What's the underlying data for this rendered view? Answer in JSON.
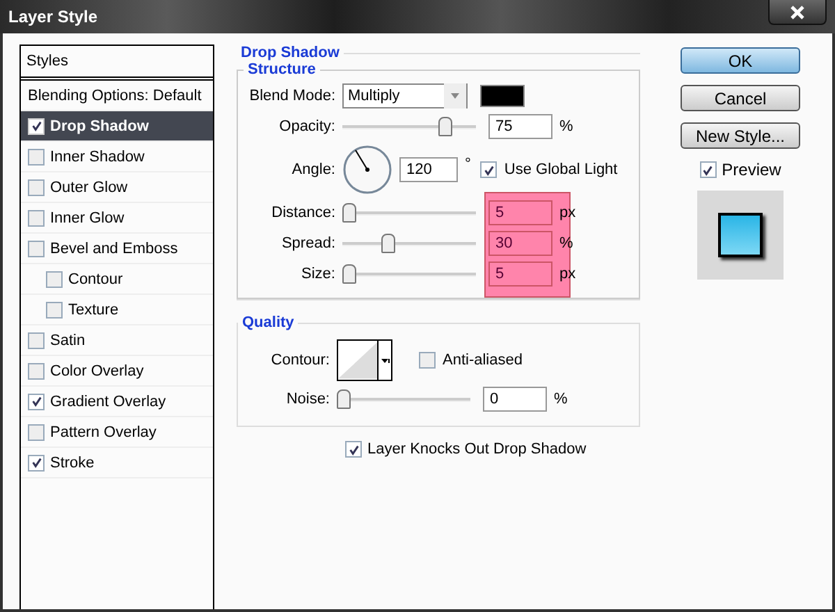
{
  "window": {
    "title": "Layer Style"
  },
  "styles_list": {
    "header": "Styles",
    "items": [
      {
        "kind": "plain",
        "label": "Blending Options: Default",
        "selected": false
      },
      {
        "kind": "check",
        "label": "Drop Shadow",
        "checked": true,
        "selected": true
      },
      {
        "kind": "check",
        "label": "Inner Shadow",
        "checked": false,
        "selected": false
      },
      {
        "kind": "check",
        "label": "Outer Glow",
        "checked": false,
        "selected": false
      },
      {
        "kind": "check",
        "label": "Inner Glow",
        "checked": false,
        "selected": false
      },
      {
        "kind": "check",
        "label": "Bevel and Emboss",
        "checked": false,
        "selected": false,
        "children": [
          {
            "kind": "check",
            "label": "Contour",
            "checked": false,
            "selected": false
          },
          {
            "kind": "check",
            "label": "Texture",
            "checked": false,
            "selected": false
          }
        ]
      },
      {
        "kind": "check",
        "label": "Satin",
        "checked": false,
        "selected": false
      },
      {
        "kind": "check",
        "label": "Color Overlay",
        "checked": false,
        "selected": false
      },
      {
        "kind": "check",
        "label": "Gradient Overlay",
        "checked": true,
        "selected": false
      },
      {
        "kind": "check",
        "label": "Pattern Overlay",
        "checked": false,
        "selected": false
      },
      {
        "kind": "check",
        "label": "Stroke",
        "checked": true,
        "selected": false
      }
    ]
  },
  "drop_shadow": {
    "title": "Drop Shadow",
    "structure": {
      "title": "Structure",
      "blend_mode": {
        "label": "Blend Mode:",
        "value": "Multiply"
      },
      "opacity": {
        "label": "Opacity:",
        "level": 0.75,
        "value": "75",
        "unit": "%"
      },
      "angle": {
        "label": "Angle:",
        "value": "120",
        "unit": "°"
      },
      "use_global_light": {
        "label": "Use Global Light",
        "checked": true
      },
      "highlighted": [
        {
          "label": "Distance:",
          "level": 0,
          "value": "5",
          "unit": "px"
        },
        {
          "label": "Spread:",
          "level": 0.3,
          "value": "30",
          "unit": "%"
        },
        {
          "label": "Size:",
          "level": 0,
          "value": "5",
          "unit": "px"
        }
      ]
    },
    "quality": {
      "title": "Quality",
      "contour": {
        "label": "Contour:"
      },
      "anti_aliased": {
        "label": "Anti-aliased",
        "checked": false
      },
      "noise": {
        "label": "Noise:",
        "level": 0,
        "value": "0",
        "unit": "%"
      }
    },
    "layer_knocks_out": {
      "label": "Layer Knocks Out Drop Shadow",
      "checked": true
    }
  },
  "buttons": [
    {
      "label": "OK",
      "kind": "default"
    },
    {
      "label": "Cancel",
      "kind": "normal"
    },
    {
      "label": "New Style...",
      "kind": "normal"
    }
  ],
  "preview": {
    "label": "Preview",
    "checked": true
  }
}
